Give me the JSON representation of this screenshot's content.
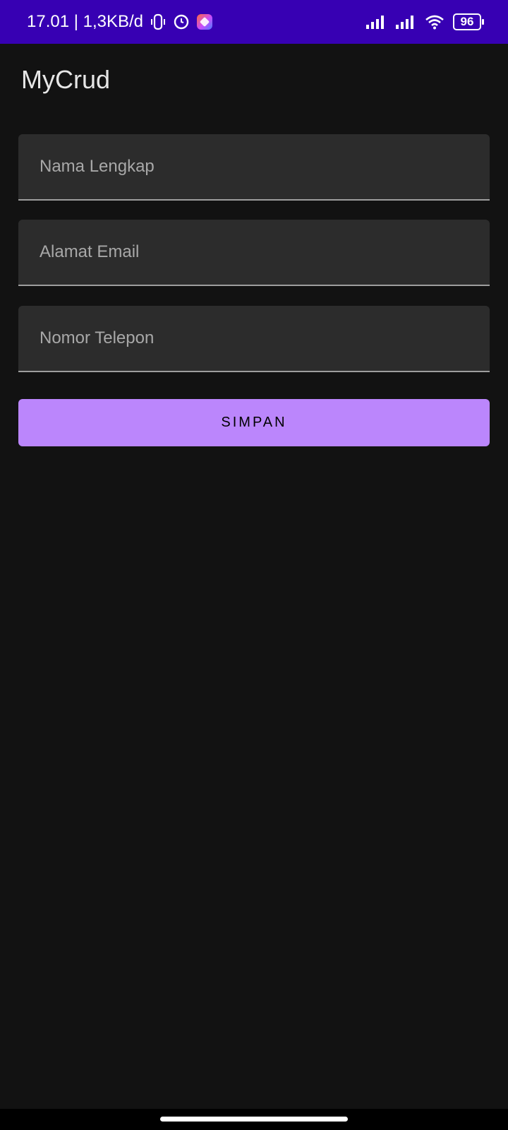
{
  "status_bar": {
    "time_net": "17.01 | 1,3KB/d",
    "battery": "96",
    "icons": [
      "vibrate-icon",
      "alarm-icon",
      "app-notification-icon",
      "signal-icon",
      "signal-icon",
      "wifi-icon",
      "battery-icon"
    ]
  },
  "app": {
    "title": "MyCrud"
  },
  "form": {
    "name_placeholder": "Nama Lengkap",
    "email_placeholder": "Alamat Email",
    "phone_placeholder": "Nomor Telepon",
    "save_label": "SIMPAN"
  },
  "colors": {
    "status_bar": "#3700b3",
    "background": "#121212",
    "field": "#2c2c2c",
    "button": "#bb86fc"
  }
}
